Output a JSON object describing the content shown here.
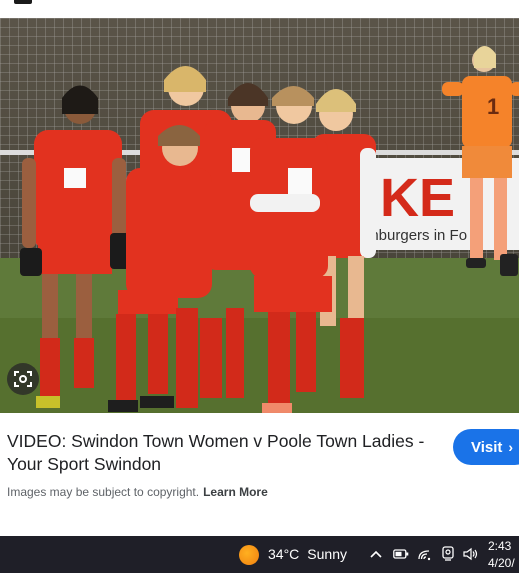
{
  "result_card": {
    "title": "VIDEO: Swindon Town Women v Poole Town Ladies - Your Sport Swindon",
    "copyright_text": "Images may be subject to copyright.",
    "learn_more": "Learn More",
    "visit_label": "Visit"
  },
  "image": {
    "banner_text": "KE",
    "banner_subtext": "anburgers in Fo",
    "keeper_number": "1"
  },
  "taskbar": {
    "temperature": "34°C",
    "condition": "Sunny",
    "time": "2:43",
    "date": "4/20/"
  },
  "icons": {
    "top": "app-icon",
    "lens": "visual-search-icon",
    "weather": "sun-icon",
    "tray": [
      "chevron-up-icon",
      "battery-icon",
      "wifi-icon",
      "camera-icon",
      "speaker-icon"
    ]
  },
  "colors": {
    "link_button": "#1a73e8",
    "taskbar": "#1f1f28",
    "kit_red": "#e2321f",
    "keeper_orange": "#f5832a"
  }
}
